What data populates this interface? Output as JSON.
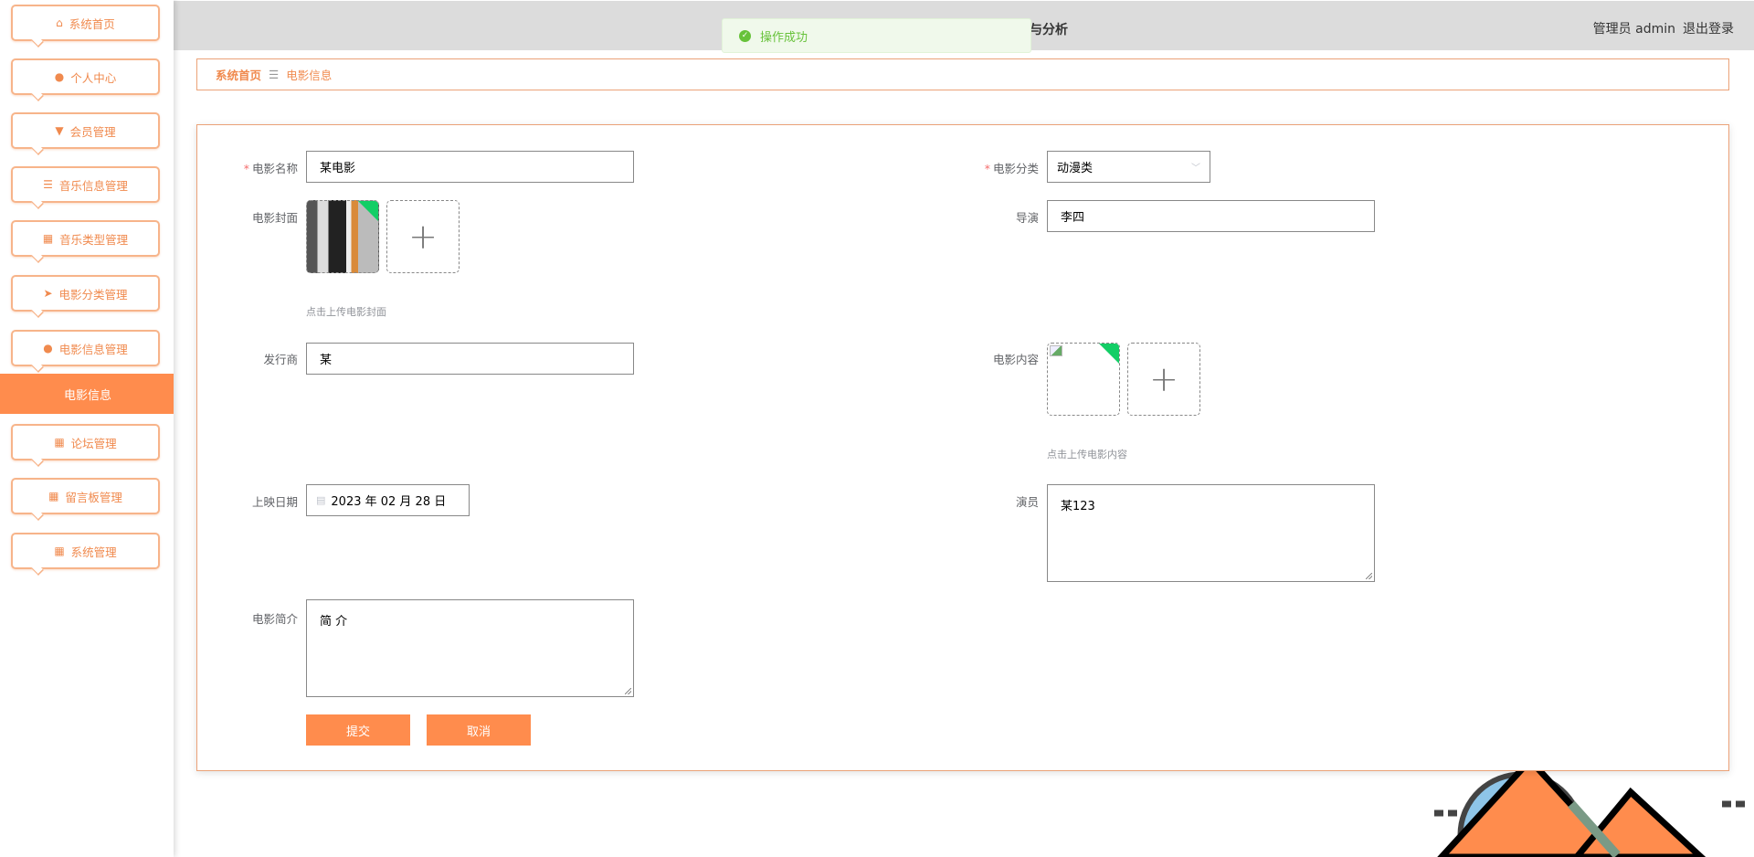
{
  "sidebar": {
    "items": [
      {
        "label": "系统首页",
        "icon": "home-icon"
      },
      {
        "label": "个人中心",
        "icon": "user-icon"
      },
      {
        "label": "会员管理",
        "icon": "member-icon"
      },
      {
        "label": "音乐信息管理",
        "icon": "list-icon"
      },
      {
        "label": "音乐类型管理",
        "icon": "grid-icon"
      },
      {
        "label": "电影分类管理",
        "icon": "send-icon"
      },
      {
        "label": "电影信息管理",
        "icon": "location-icon"
      },
      {
        "label": "论坛管理",
        "icon": "grid-icon"
      },
      {
        "label": "留言板管理",
        "icon": "grid-icon"
      },
      {
        "label": "系统管理",
        "icon": "grid-icon"
      }
    ],
    "active_sub": "电影信息"
  },
  "header": {
    "title_visible": "与分析",
    "role": "管理员 admin",
    "logout": "退出登录"
  },
  "toast": {
    "message": "操作成功"
  },
  "breadcrumb": {
    "home": "系统首页",
    "current": "电影信息"
  },
  "form": {
    "name": {
      "label": "电影名称",
      "value": "某电影"
    },
    "category": {
      "label": "电影分类",
      "value": "动漫类"
    },
    "cover": {
      "label": "电影封面",
      "hint": "点击上传电影封面"
    },
    "director": {
      "label": "导演",
      "value": "李四"
    },
    "publisher": {
      "label": "发行商",
      "value": "某"
    },
    "content": {
      "label": "电影内容",
      "hint": "点击上传电影内容"
    },
    "date": {
      "label": "上映日期",
      "value": "2023 年 02 月 28 日"
    },
    "actors": {
      "label": "演员",
      "value": "某123"
    },
    "intro": {
      "label": "电影简介",
      "value": "简 介"
    },
    "submit": "提交",
    "cancel": "取消"
  },
  "colors": {
    "accent": "#ff8c4d",
    "success": "#67c23a"
  }
}
